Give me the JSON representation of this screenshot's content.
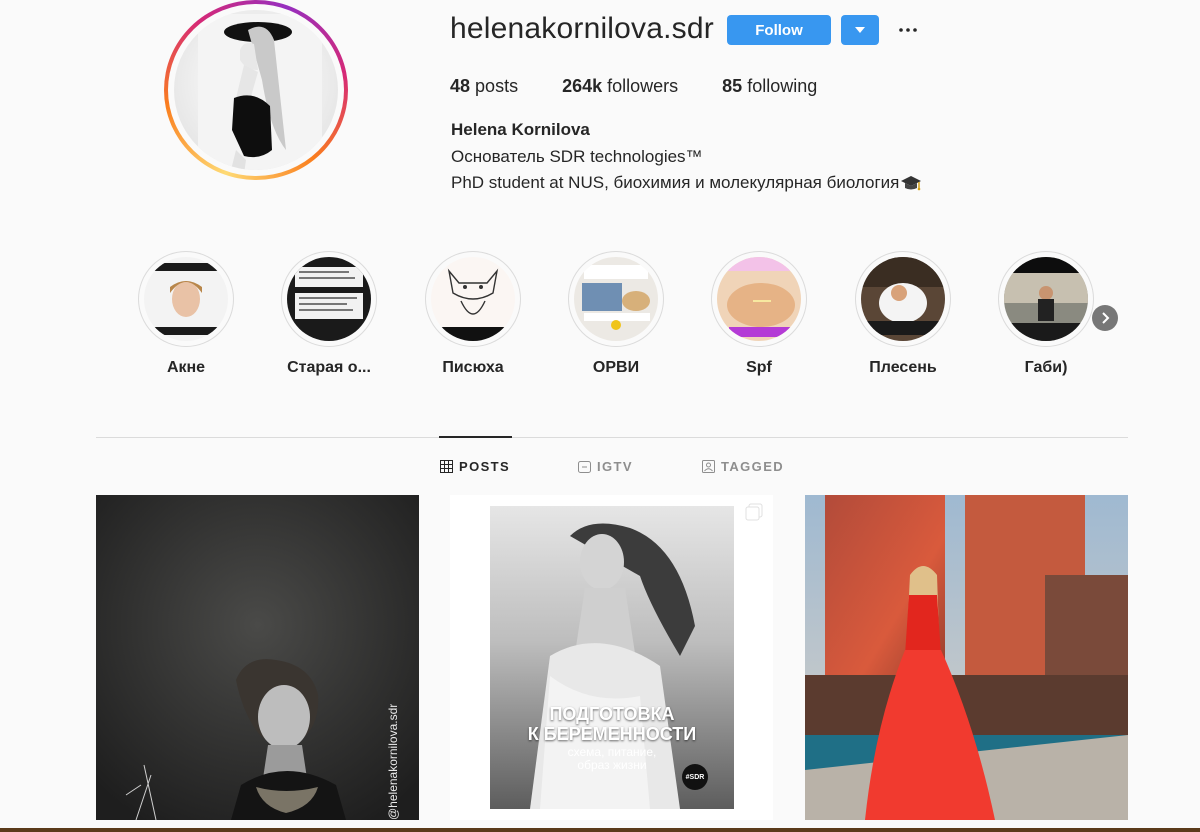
{
  "profile": {
    "username": "helenakornilova.sdr",
    "follow_label": "Follow",
    "stats": {
      "posts_count": "48",
      "posts_label": "posts",
      "followers_count": "264k",
      "followers_label": "followers",
      "following_count": "85",
      "following_label": "following"
    },
    "full_name": "Helena Kornilova",
    "bio_line1": "Основатель SDR technologies™",
    "bio_line2": "PhD student at NUS, биохимия и молекулярная биология"
  },
  "highlights": [
    {
      "label": "Акне"
    },
    {
      "label": "Старая о..."
    },
    {
      "label": "Писюха"
    },
    {
      "label": "ОРВИ"
    },
    {
      "label": "Spf"
    },
    {
      "label": "Плесень"
    },
    {
      "label": "Габи)"
    }
  ],
  "tabs": [
    {
      "label": "POSTS",
      "icon": "grid-icon",
      "active": true
    },
    {
      "label": "IGTV",
      "icon": "igtv-icon",
      "active": false
    },
    {
      "label": "TAGGED",
      "icon": "tagged-icon",
      "active": false
    }
  ],
  "posts": [
    {
      "watermark": "@helenakornilova.sdr"
    },
    {
      "title_line1": "ПОДГОТОВКА",
      "title_line2": "К БЕРЕМЕННОСТИ",
      "subtitle_line1": "схема, питание,",
      "subtitle_line2": "образ жизни",
      "badge": "#SDR"
    },
    {}
  ],
  "colors": {
    "background": "#fafafa",
    "follow_blue": "#3897f0",
    "text": "#262626",
    "divider": "#dbdbdb"
  }
}
